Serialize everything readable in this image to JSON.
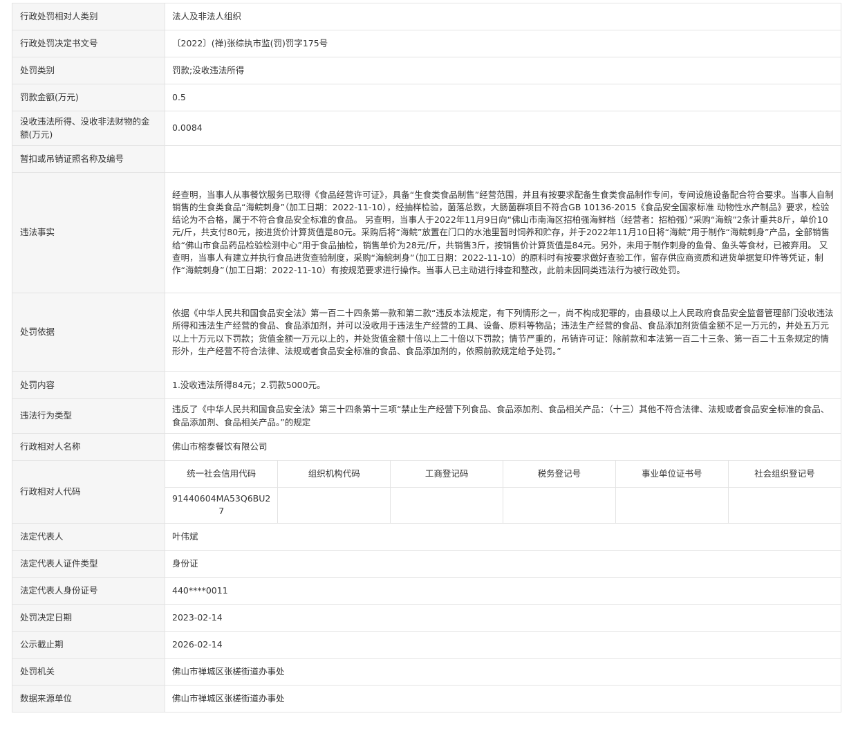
{
  "rows": [
    {
      "label": "行政处罚相对人类别",
      "value": "法人及非法人组织"
    },
    {
      "label": "行政处罚决定书文号",
      "value": "〔2022〕(禅)张综执市监(罚)罚字175号"
    },
    {
      "label": "处罚类别",
      "value": "罚款;没收违法所得"
    },
    {
      "label": "罚款金额(万元)",
      "value": "0.5"
    },
    {
      "label": "没收违法所得、没收非法财物的金额(万元)",
      "value": "0.0084"
    },
    {
      "label": "暂扣或吊销证照名称及编号",
      "value": ""
    },
    {
      "label": "违法事实",
      "value": "经查明，当事人从事餐饮服务已取得《食品经营许可证》，具备“生食类食品制售”经营范围，并且有按要求配备生食类食品制作专间，专间设施设备配合符合要求。当事人自制销售的生食类食品“海鲩刺身”（加工日期：2022-11-10），经抽样检验，菌落总数，大肠菌群项目不符合GB 10136-2015《食品安全国家标准 动物性水产制品》要求，检验结论为不合格，属于不符合食品安全标准的食品。 另查明，当事人于2022年11月9日向“佛山市南海区招柏强海鲜档（经营者：招柏强）”采购“海鲩”2条计重共8斤，单价10元/斤，共支付80元，按进货价计算货值是80元。采购后将“海鲩”放置在门口的水池里暂时饲养和贮存，并于2022年11月10日将“海鲩”用于制作“海鲩刺身”产品，全部销售给“佛山市食品药品检验检测中心”用于食品抽检，销售单价为28元/斤，共销售3斤，按销售价计算货值是84元。另外，未用于制作刺身的鱼骨、鱼头等食材，已被弃用。 又查明，当事人有建立并执行食品进货查验制度，采购“海鲩刺身”（加工日期：2022-11-10）的原料时有按要求做好查验工作，留存供应商资质和进货单据复印件等凭证，制作“海鲩刺身”（加工日期：2022-11-10）有按规范要求进行操作。当事人已主动进行排查和整改，此前未因同类违法行为被行政处罚。"
    },
    {
      "label": "处罚依据",
      "value": "依据《中华人民共和国食品安全法》第一百二十四条第一款和第二款“违反本法规定，有下列情形之一，尚不构成犯罪的，由县级以上人民政府食品安全监督管理部门没收违法所得和违法生产经营的食品、食品添加剂，并可以没收用于违法生产经营的工具、设备、原料等物品；违法生产经营的食品、食品添加剂货值金额不足一万元的，并处五万元以上十万元以下罚款；货值金额一万元以上的，并处货值金额十倍以上二十倍以下罚款；情节严重的，吊销许可证：除前款和本法第一百二十三条、第一百二十五条规定的情形外，生产经营不符合法律、法规或者食品安全标准的食品、食品添加剂的，依照前款规定给予处罚。”"
    },
    {
      "label": "处罚内容",
      "value": "1.没收违法所得84元；2.罚款5000元。"
    },
    {
      "label": "违法行为类型",
      "value": "违反了《中华人民共和国食品安全法》第三十四条第十三项“禁止生产经营下列食品、食品添加剂、食品相关产品：（十三）其他不符合法律、法规或者食品安全标准的食品、食品添加剂、食品相关产品。”的规定"
    },
    {
      "label": "行政相对人名称",
      "value": "佛山市榕泰餐饮有限公司"
    }
  ],
  "codes": {
    "label": "行政相对人代码",
    "headers": [
      "统一社会信用代码",
      "组织机构代码",
      "工商登记码",
      "税务登记号",
      "事业单位证书号",
      "社会组织登记号"
    ],
    "values": [
      "91440604MA53Q6BU27",
      "",
      "",
      "",
      "",
      ""
    ]
  },
  "rows_after": [
    {
      "label": "法定代表人",
      "value": "叶伟斌"
    },
    {
      "label": "法定代表人证件类型",
      "value": "身份证"
    },
    {
      "label": "法定代表人身份证号",
      "value": "440****0011"
    },
    {
      "label": "处罚决定日期",
      "value": "2023-02-14"
    },
    {
      "label": "公示截止期",
      "value": "2026-02-14"
    },
    {
      "label": "处罚机关",
      "value": "佛山市禅城区张槎街道办事处"
    },
    {
      "label": "数据来源单位",
      "value": "佛山市禅城区张槎街道办事处"
    }
  ]
}
